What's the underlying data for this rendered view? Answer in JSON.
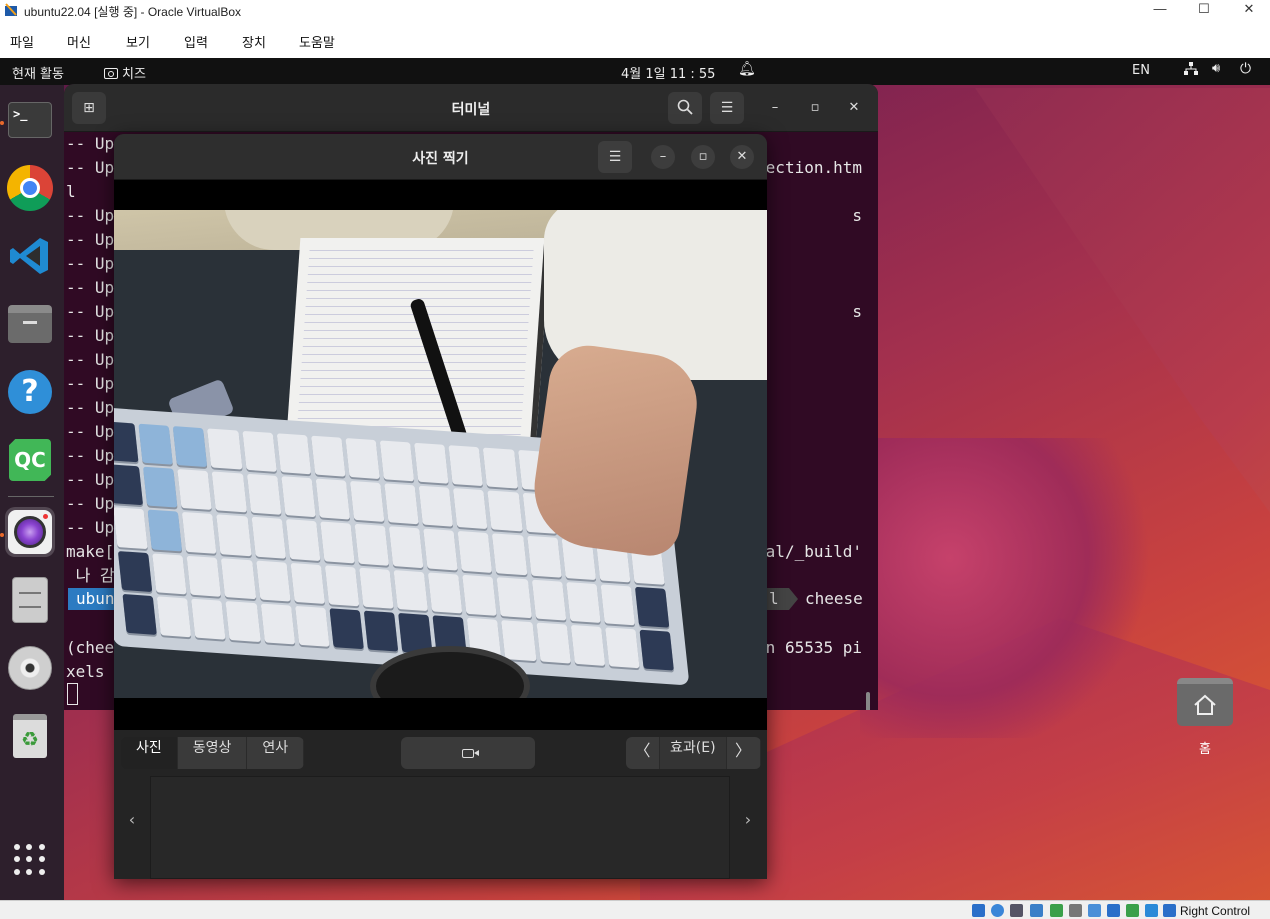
{
  "vbox": {
    "title": "ubuntu22.04 [실행 중] - Oracle VirtualBox",
    "menu": [
      "파일",
      "머신",
      "보기",
      "입력",
      "장치",
      "도움말"
    ],
    "window_controls": {
      "minimize": "—",
      "maximize": "☐",
      "close": "✕"
    },
    "host_key": "Right Control"
  },
  "topbar": {
    "activities": "현재 활동",
    "app_name": "치즈",
    "clock": "4월 1일  11 : 55",
    "lang": "EN"
  },
  "dock": {
    "items": [
      {
        "name": "terminal",
        "label": ">_",
        "active": false,
        "running": true
      },
      {
        "name": "chrome",
        "active": false,
        "running": false
      },
      {
        "name": "vscode",
        "active": false,
        "running": false
      },
      {
        "name": "files",
        "active": false,
        "running": false
      },
      {
        "name": "help",
        "label": "?",
        "active": false,
        "running": false
      },
      {
        "name": "qtcreator",
        "label": "QC",
        "active": false,
        "running": false
      },
      {
        "name": "cheese",
        "active": true,
        "running": true
      },
      {
        "name": "disk",
        "active": false,
        "running": false
      },
      {
        "name": "cd",
        "active": false,
        "running": false
      },
      {
        "name": "trash",
        "label": "♻",
        "active": false,
        "running": false
      }
    ]
  },
  "desktop": {
    "home_label": "홈"
  },
  "terminal": {
    "title": "터미널",
    "left_lines": [
      "-- Up",
      "-- Up",
      "l",
      "-- Up",
      "-- Up",
      "-- Up",
      "-- Up",
      "-- Up",
      "-- Up",
      "-- Up",
      "-- Up",
      "-- Up",
      "-- Up",
      "-- Up",
      "-- Up",
      "-- Up",
      "-- Up",
      "make[",
      " 나 감",
      "",
      "",
      "(chee",
      "xels"
    ],
    "right_fragments": [
      {
        "line": 1,
        "text": "ection.htm"
      },
      {
        "line": 3,
        "text": "s"
      },
      {
        "line": 7,
        "text": "s"
      },
      {
        "line": 17,
        "text": "al/_build'"
      },
      {
        "line": 21,
        "text": "n 65535 pi"
      }
    ],
    "prompt_user": "ubun",
    "prompt_dir": "l",
    "prompt_command": "cheese"
  },
  "cheese": {
    "title": "사진 찍기",
    "modes": [
      "사진",
      "동영상",
      "연사"
    ],
    "selected_mode": "사진",
    "effects_label": "효과(E)",
    "prev_arrow": "〈",
    "next_arrow": "〉",
    "thumb_prev": "‹",
    "thumb_next": "›"
  }
}
